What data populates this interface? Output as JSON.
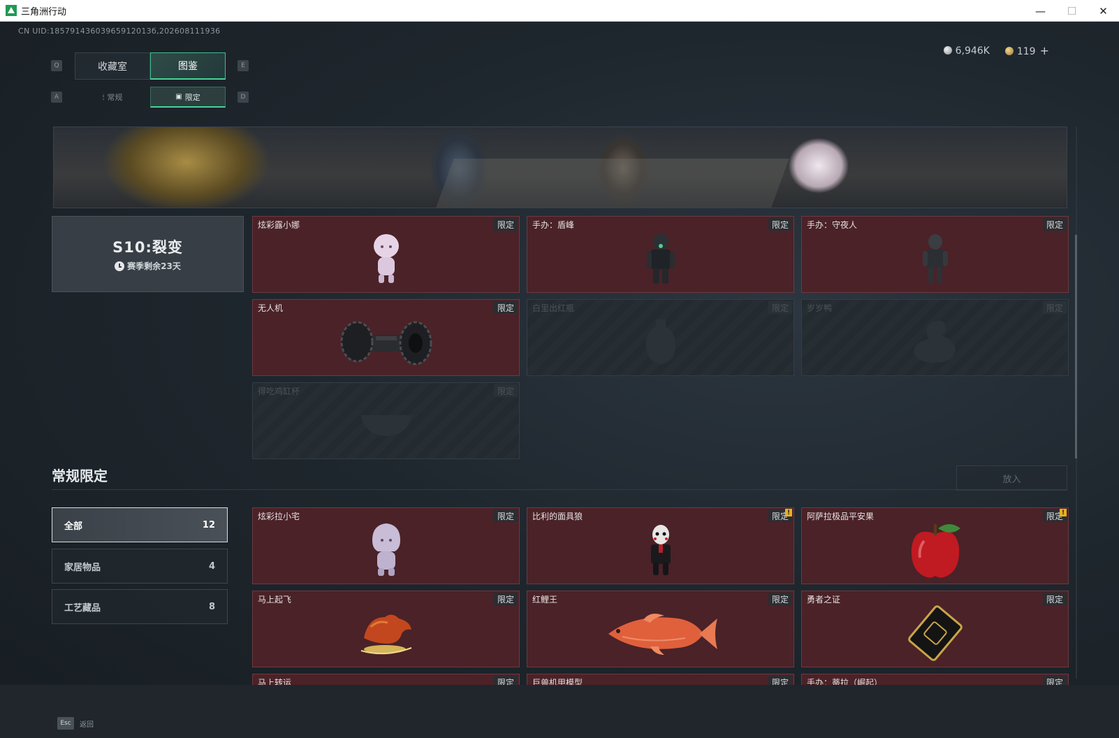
{
  "window": {
    "title": "三角洲行动",
    "minimize": "—",
    "maximize": "☐",
    "close": "✕"
  },
  "uid": "CN UID:18579143603965912013б,202608111936",
  "currency": {
    "silver": "6,946K",
    "gold": "119",
    "plus": "+"
  },
  "keys": {
    "prev_tab": "Q",
    "next_tab": "E",
    "prev_sub": "A",
    "next_sub": "D",
    "esc": "Esc"
  },
  "tabs": [
    {
      "label": "收藏室",
      "active": false
    },
    {
      "label": "图鉴",
      "active": true
    }
  ],
  "subtabs": [
    {
      "label": "常规",
      "icon": "flame-icon",
      "active": false
    },
    {
      "label": "限定",
      "icon": "image-icon",
      "active": true
    }
  ],
  "season": {
    "title": "S10:裂变",
    "remaining": "赛季剩余23天"
  },
  "season_items": [
    {
      "name": "炫彩露小娜",
      "tag": "限定",
      "locked": false
    },
    {
      "name": "手办：盾峰",
      "tag": "限定",
      "locked": false
    },
    {
      "name": "手办：守夜人",
      "tag": "限定",
      "locked": false
    },
    {
      "name": "无人机",
      "tag": "限定",
      "locked": false
    },
    {
      "name": "白里出红瓶",
      "tag": "限定",
      "locked": true
    },
    {
      "name": "岁岁鸭",
      "tag": "限定",
      "locked": true
    },
    {
      "name": "得吃鸡缸杯",
      "tag": "限定",
      "locked": true
    }
  ],
  "section": {
    "title": "常规限定",
    "release_label": "放入"
  },
  "filters": [
    {
      "label": "全部",
      "count": "12",
      "active": true
    },
    {
      "label": "家居物品",
      "count": "4",
      "active": false
    },
    {
      "label": "工艺藏品",
      "count": "8",
      "active": false
    }
  ],
  "regular_items": [
    {
      "name": "炫彩拉小宅",
      "tag": "限定",
      "alert": false
    },
    {
      "name": "比利的面具狼",
      "tag": "限定",
      "alert": true
    },
    {
      "name": "阿萨拉极品平安果",
      "tag": "限定",
      "alert": true
    },
    {
      "name": "马上起飞",
      "tag": "限定",
      "alert": false
    },
    {
      "name": "红鲤王",
      "tag": "限定",
      "alert": false
    },
    {
      "name": "勇者之证",
      "tag": "限定",
      "alert": false
    },
    {
      "name": "马上转运",
      "tag": "限定",
      "alert": false
    },
    {
      "name": "巨兽机甲模型",
      "tag": "限定",
      "alert": false
    },
    {
      "name": "手办：蒂拉（崛起）",
      "tag": "限定",
      "alert": false
    }
  ],
  "alert_mark": "!",
  "footer": {
    "back_label": "返回"
  },
  "colors": {
    "accent": "#44d497",
    "card_bg": "#4a2228",
    "alert": "#e7b21e"
  }
}
